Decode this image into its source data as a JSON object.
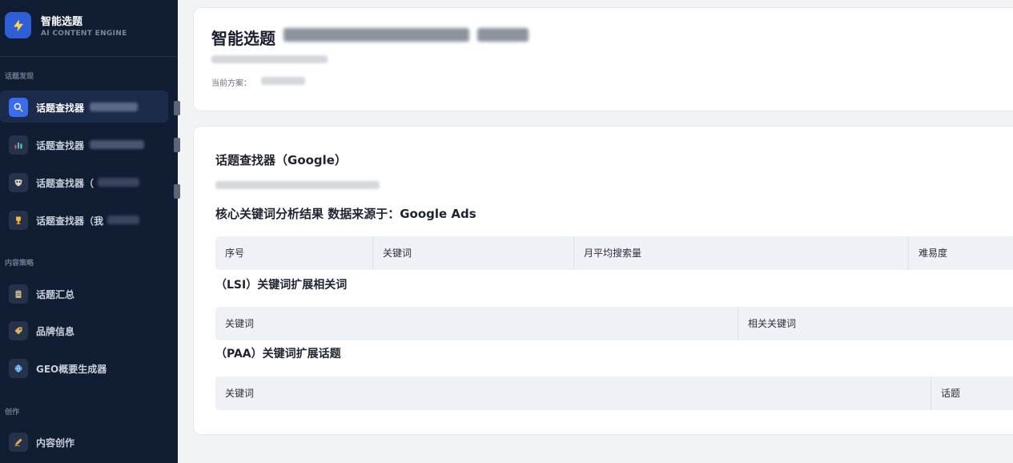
{
  "sidebar": {
    "brand_title": "智能选题",
    "brand_subtitle": "AI CONTENT ENGINE",
    "sections": {
      "discovery": "话题发现",
      "strategy": "内容策略",
      "creation": "创作"
    },
    "items": [
      {
        "label": "话题查找器",
        "icon": "search-icon",
        "active": true
      },
      {
        "label": "话题查找器",
        "icon": "chart-icon",
        "active": false
      },
      {
        "label": "话题查找器（",
        "icon": "mask-icon",
        "active": false
      },
      {
        "label": "话题查找器（我",
        "icon": "trophy-icon",
        "active": false
      },
      {
        "label": "话题汇总",
        "icon": "clipboard-icon",
        "active": false
      },
      {
        "label": "品牌信息",
        "icon": "tag-icon",
        "active": false
      },
      {
        "label": "GEO概要生成器",
        "icon": "globe-icon",
        "active": false
      },
      {
        "label": "内容创作",
        "icon": "pen-icon",
        "active": false
      }
    ]
  },
  "header": {
    "title": "智能选题",
    "plan_label": "当前方案："
  },
  "finder": {
    "title": "话题查找器（Google）",
    "core_title": "核心关键词分析结果 数据来源于：Google Ads",
    "core_columns": [
      "序号",
      "关键词",
      "月平均搜索量",
      "难易度"
    ],
    "lsi_title": "（LSI）关键词扩展相关词",
    "lsi_columns": [
      "关键词",
      "相关关键词"
    ],
    "paa_title": "（PAA）关键词扩展话题",
    "paa_columns": [
      "关键词",
      "话题"
    ]
  },
  "colors": {
    "sidebar_bg": "#111d33",
    "accent": "#3a6cf0",
    "table_header_bg": "#eef1f5"
  }
}
